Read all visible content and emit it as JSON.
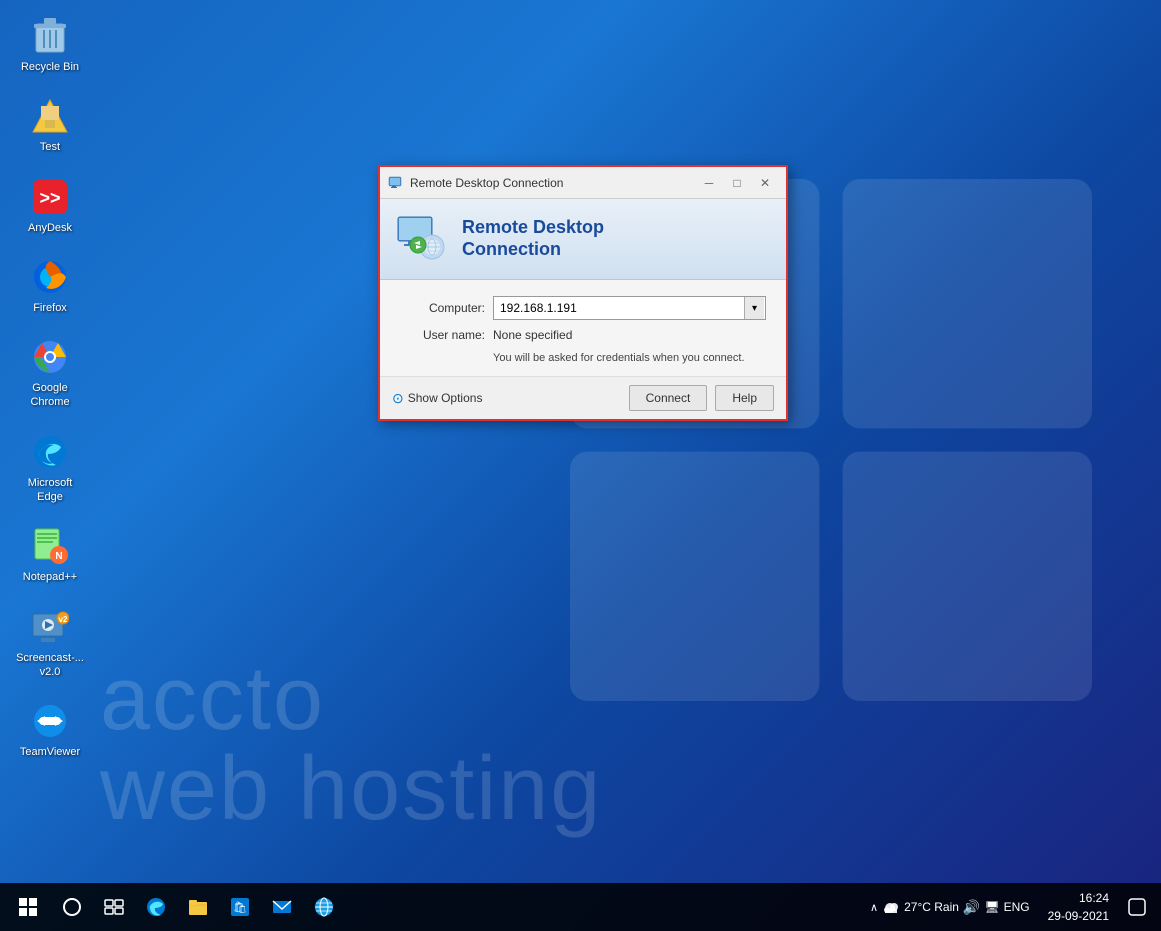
{
  "desktop": {
    "background": "#1565c0",
    "watermark_text1": "accto",
    "watermark_text2": "web hosting"
  },
  "icons": [
    {
      "id": "recycle-bin",
      "label": "Recycle Bin",
      "symbol": "🗑️"
    },
    {
      "id": "test",
      "label": "Test",
      "symbol": "📁"
    },
    {
      "id": "anydesk",
      "label": "AnyDesk",
      "symbol": "🔴"
    },
    {
      "id": "firefox",
      "label": "Firefox",
      "symbol": "🦊"
    },
    {
      "id": "google-chrome",
      "label": "Google Chrome",
      "symbol": "🌐"
    },
    {
      "id": "microsoft-edge",
      "label": "Microsoft Edge",
      "symbol": "🌀"
    },
    {
      "id": "notepadpp",
      "label": "Notepad++",
      "symbol": "📝"
    },
    {
      "id": "screencast",
      "label": "Screencast-...\nv2.0",
      "symbol": "🎬"
    },
    {
      "id": "teamviewer",
      "label": "TeamViewer",
      "symbol": "↔️"
    }
  ],
  "dialog": {
    "title": "Remote Desktop Connection",
    "minimize_label": "─",
    "maximize_label": "□",
    "close_label": "✕",
    "header": {
      "line1": "Remote Desktop",
      "line2": "Connection"
    },
    "computer_label": "Computer:",
    "computer_value": "192.168.1.191",
    "username_label": "User name:",
    "username_value": "None specified",
    "credentials_note": "You will be asked for credentials when you connect.",
    "show_options_label": "Show Options",
    "connect_label": "Connect",
    "help_label": "Help"
  },
  "taskbar": {
    "start_icon": "⊞",
    "search_icon": "○",
    "taskview_icon": "⧉",
    "edge_icon": "🌀",
    "explorer_icon": "📁",
    "store_icon": "🛍️",
    "mail_icon": "✉️",
    "globe_icon": "🌐",
    "weather_text": "27°C Rain",
    "language": "ENG",
    "time": "16:24",
    "date": "29-09-2021",
    "notification_icon": "💬"
  }
}
